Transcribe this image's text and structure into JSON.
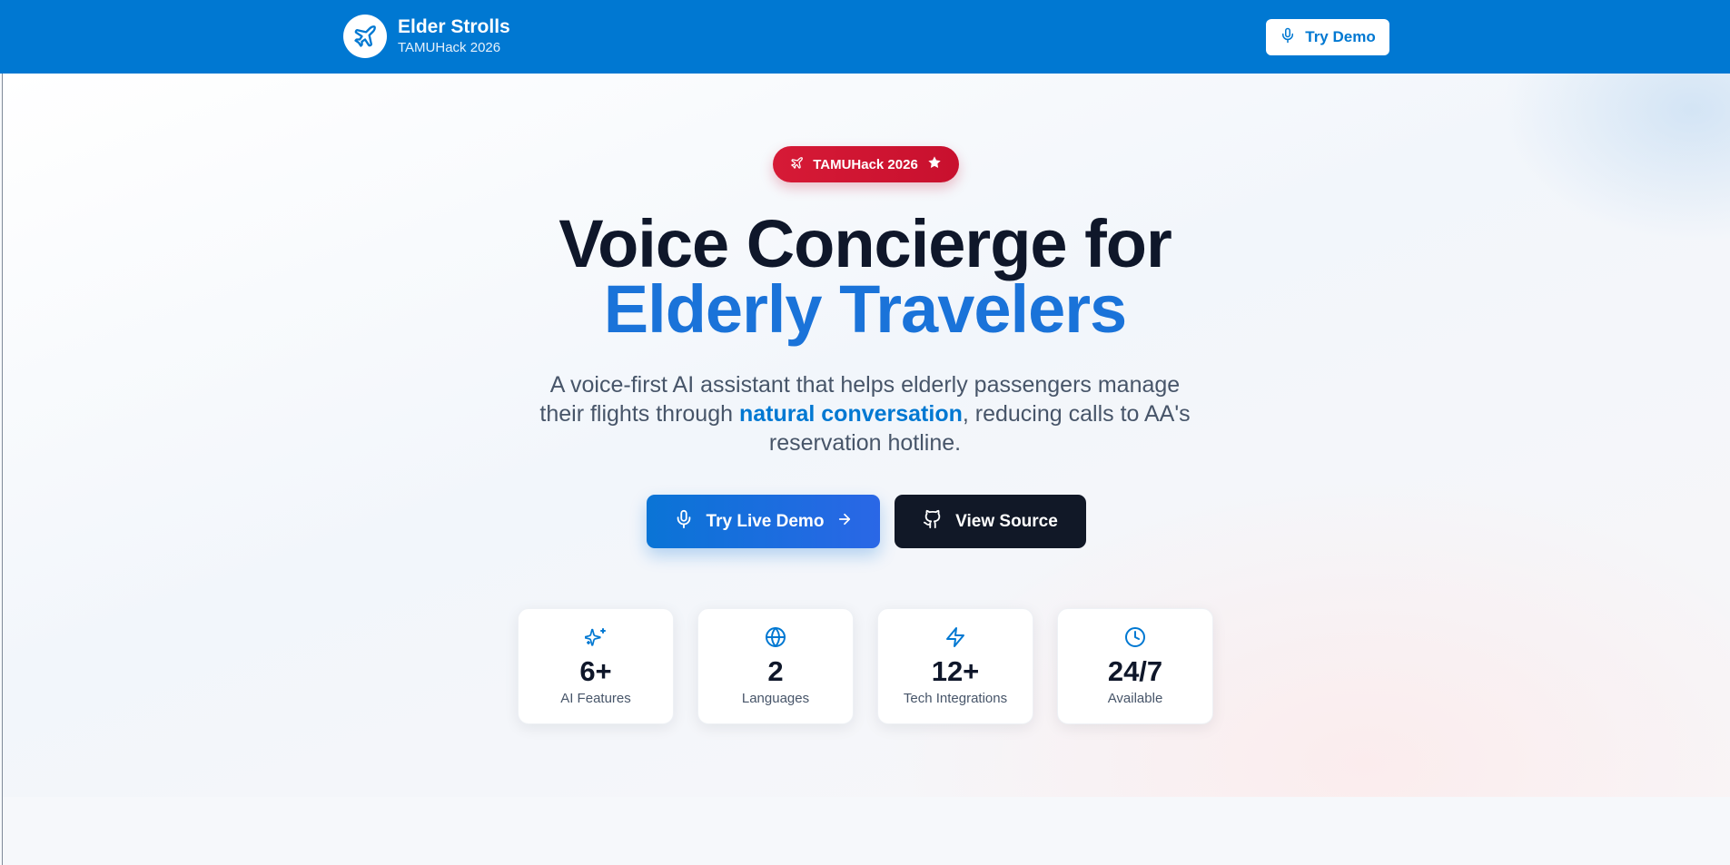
{
  "header": {
    "brand_name": "Elder Strolls",
    "brand_sub": "TAMUHack 2026",
    "demo_button": "Try Demo",
    "brand_color": "#0078d2"
  },
  "hero": {
    "badge": "TAMUHack 2026",
    "title_line1": "Voice Concierge for",
    "title_line2": "Elderly Travelers",
    "subtitle_before": "A voice-first AI assistant that helps elderly passengers manage their flights through ",
    "subtitle_highlight": "natural conversation",
    "subtitle_after": ", reducing calls to AA's reservation hotline.",
    "primary_cta": "Try Live Demo",
    "secondary_cta": "View Source",
    "accent_color": "#1a73d9",
    "badge_color": "#c8102e"
  },
  "stats": [
    {
      "icon": "sparkles-icon",
      "value": "6+",
      "label": "AI Features"
    },
    {
      "icon": "globe-icon",
      "value": "2",
      "label": "Languages"
    },
    {
      "icon": "lightning-icon",
      "value": "12+",
      "label": "Tech Integrations"
    },
    {
      "icon": "clock-icon",
      "value": "24/7",
      "label": "Available"
    }
  ]
}
